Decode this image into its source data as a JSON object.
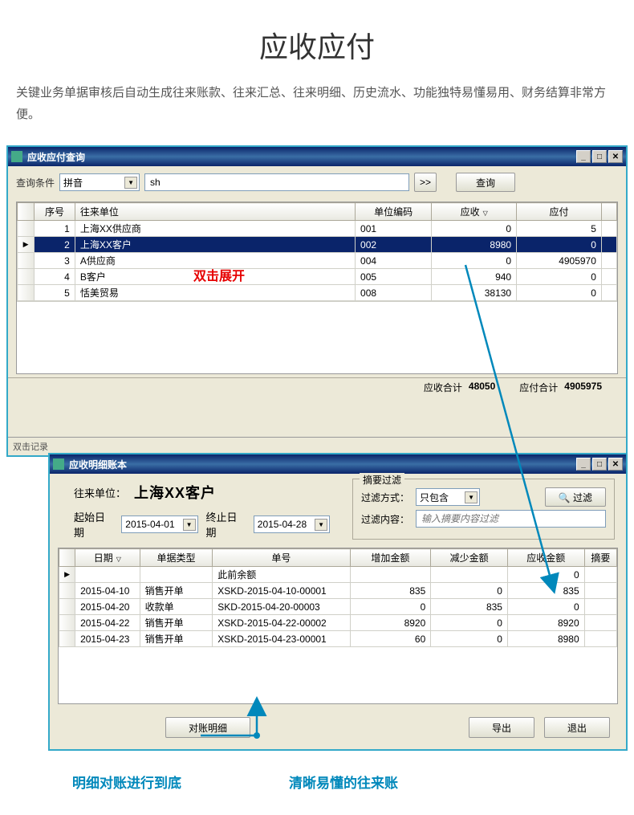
{
  "page": {
    "title": "应收应付",
    "description": "关键业务单据审核后自动生成往来账款、往来汇总、往来明细、历史流水、功能独特易懂易用、财务结算非常方便。"
  },
  "window1": {
    "title": "应收应付查询",
    "query_label": "查询条件",
    "query_type": "拼音",
    "query_value": "sh",
    "query_btn": "查询",
    "columns": [
      "序号",
      "往来单位",
      "单位编码",
      "应收",
      "应付"
    ],
    "rows": [
      {
        "no": "1",
        "unit": "上海XX供应商",
        "code": "001",
        "recv": "0",
        "pay": "5"
      },
      {
        "no": "2",
        "unit": "上海XX客户",
        "code": "002",
        "recv": "8980",
        "pay": "0"
      },
      {
        "no": "3",
        "unit": "A供应商",
        "code": "004",
        "recv": "0",
        "pay": "4905970"
      },
      {
        "no": "4",
        "unit": "B客户",
        "code": "005",
        "recv": "940",
        "pay": "0"
      },
      {
        "no": "5",
        "unit": "恬美贸易",
        "code": "008",
        "recv": "38130",
        "pay": "0"
      }
    ],
    "sum_recv_label": "应收合计",
    "sum_recv": "48050",
    "sum_pay_label": "应付合计",
    "sum_pay": "4905975",
    "status": "双击记录",
    "overlay_note": "双击展开"
  },
  "window2": {
    "title": "应收明细账本",
    "unit_label": "往来单位：",
    "unit_value": "上海XX客户",
    "start_label": "起始日期",
    "start_value": "2015-04-01",
    "end_label": "终止日期",
    "end_value": "2015-04-28",
    "filter_legend": "摘要过滤",
    "filter_mode_label": "过滤方式：",
    "filter_mode": "只包含",
    "filter_btn": "过滤",
    "filter_content_label": "过滤内容：",
    "filter_content_placeholder": "输入摘要内容过滤",
    "columns": [
      "日期",
      "单据类型",
      "单号",
      "增加金额",
      "减少金额",
      "应收金额",
      "摘要"
    ],
    "opening_label": "此前余额",
    "rows": [
      {
        "date": "",
        "type": "",
        "no": "此前余额",
        "inc": "",
        "dec": "",
        "bal": "0",
        "memo": ""
      },
      {
        "date": "2015-04-10",
        "type": "销售开单",
        "no": "XSKD-2015-04-10-00001",
        "inc": "835",
        "dec": "0",
        "bal": "835",
        "memo": ""
      },
      {
        "date": "2015-04-20",
        "type": "收款单",
        "no": "SKD-2015-04-20-00003",
        "inc": "0",
        "dec": "835",
        "bal": "0",
        "memo": ""
      },
      {
        "date": "2015-04-22",
        "type": "销售开单",
        "no": "XSKD-2015-04-22-00002",
        "inc": "8920",
        "dec": "0",
        "bal": "8920",
        "memo": ""
      },
      {
        "date": "2015-04-23",
        "type": "销售开单",
        "no": "XSKD-2015-04-23-00001",
        "inc": "60",
        "dec": "0",
        "bal": "8980",
        "memo": ""
      }
    ],
    "btn_detail": "对账明细",
    "btn_export": "导出",
    "btn_exit": "退出"
  },
  "annotations": {
    "left": "明细对账进行到底",
    "right": "清晰易懂的往来账"
  },
  "icons": {
    "minimize": "_",
    "maximize": "□",
    "close": "✕",
    "dropdown": "▼",
    "nav": ">>",
    "search": "🔍"
  }
}
